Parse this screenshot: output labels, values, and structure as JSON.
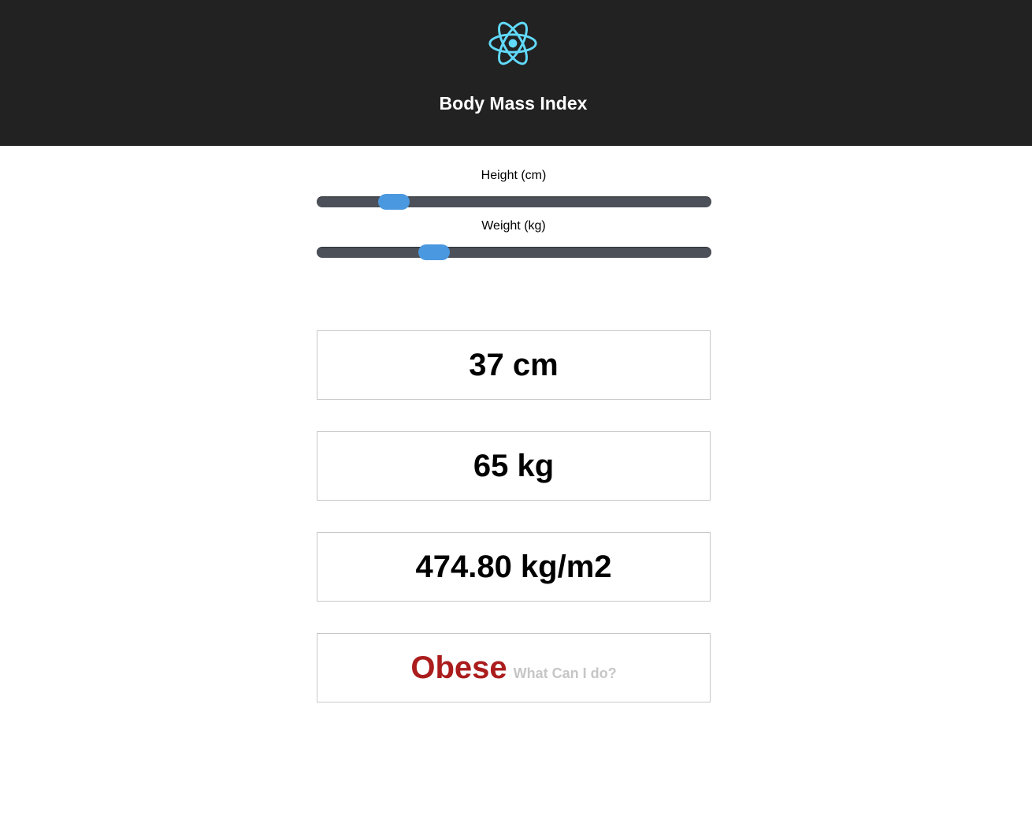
{
  "header": {
    "title": "Body Mass Index",
    "logo_icon": "react-atom-icon",
    "background": "#222222",
    "logo_color": "#61dafb"
  },
  "controls": {
    "height_label": "Height (cm)",
    "height_slider_fraction": 0.17,
    "weight_label": "Weight (kg)",
    "weight_slider_fraction": 0.28,
    "track_color": "#4c5059",
    "thumb_color": "#4a98df"
  },
  "results": {
    "height": "37 cm",
    "weight": "65 kg",
    "bmi": "474.80 kg/m2",
    "category": "Obese",
    "category_color": "#ab1c1c",
    "help_link": "What Can I do?"
  }
}
